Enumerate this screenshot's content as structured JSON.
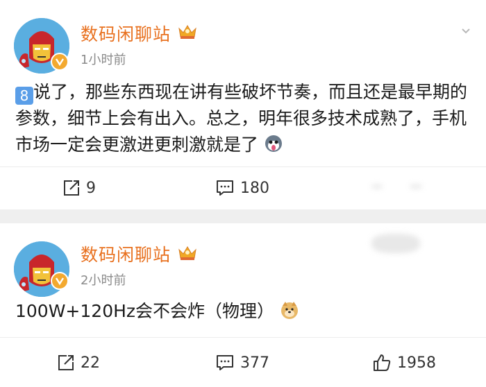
{
  "posts": [
    {
      "username": "数码闲聊站",
      "time": "1小时前",
      "text_emoji": "8",
      "text": "说了，那些东西现在讲有些破坏节奏，而且还是最早期的参数，细节上会有出入。总之，明年很多技术成熟了，手机市场一定会更激进更刺激就是了",
      "actions": {
        "repost": "9",
        "comments": "180"
      }
    },
    {
      "username": "数码闲聊站",
      "time": "2小时前",
      "text": "100W+120Hz会不会炸（物理）",
      "actions": {
        "repost": "22",
        "comments": "377",
        "likes": "1958"
      }
    }
  ],
  "colors": {
    "username": "#e8701e",
    "verified": "#f3a92f",
    "time": "#8a8a8a"
  },
  "icons": [
    "avatar-ironman",
    "verified-badge-icon",
    "crown-badge-icon",
    "chevron-down-icon",
    "repost-icon",
    "comment-icon",
    "like-icon",
    "husky-emoji-icon",
    "doge-emoji-icon"
  ]
}
